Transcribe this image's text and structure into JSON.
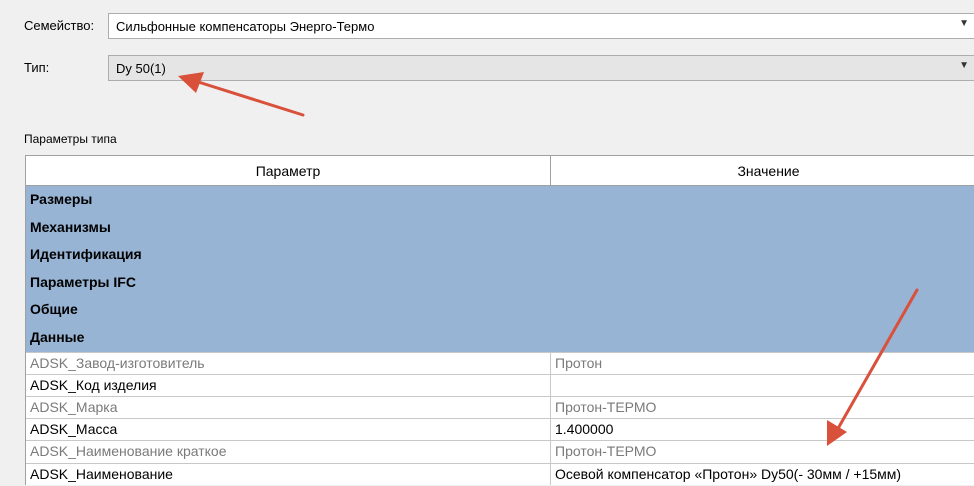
{
  "family": {
    "label": "Семейство:",
    "value": "Сильфонные компенсаторы Энерго-Термо"
  },
  "type": {
    "label": "Тип:",
    "value": "Dy 50(1)"
  },
  "section_title": "Параметры типа",
  "columns": {
    "parameter": "Параметр",
    "value": "Значение"
  },
  "groups": [
    "Размеры",
    "Механизмы",
    "Идентификация",
    "Параметры IFC",
    "Общие",
    "Данные"
  ],
  "rows": [
    {
      "name": "ADSK_Завод-изготовитель",
      "value": "Протон",
      "editable": false
    },
    {
      "name": "ADSK_Код изделия",
      "value": "",
      "editable": true
    },
    {
      "name": "ADSK_Марка",
      "value": "Протон-ТЕРМО",
      "editable": false
    },
    {
      "name": "ADSK_Масса",
      "value": "1.400000",
      "editable": true
    },
    {
      "name": "ADSK_Наименование краткое",
      "value": "Протон-ТЕРМО",
      "editable": false
    },
    {
      "name": "ADSK_Наименование",
      "value": "Осевой компенсатор «Протон» Dy50(- 30мм / +15мм)",
      "editable": true
    }
  ],
  "icons": {
    "dropdown": "chevron-down-icon"
  },
  "colors": {
    "group_band": "#98b4d4",
    "annotation_arrow": "#d9503b",
    "dim_text": "#7a7a7a"
  }
}
